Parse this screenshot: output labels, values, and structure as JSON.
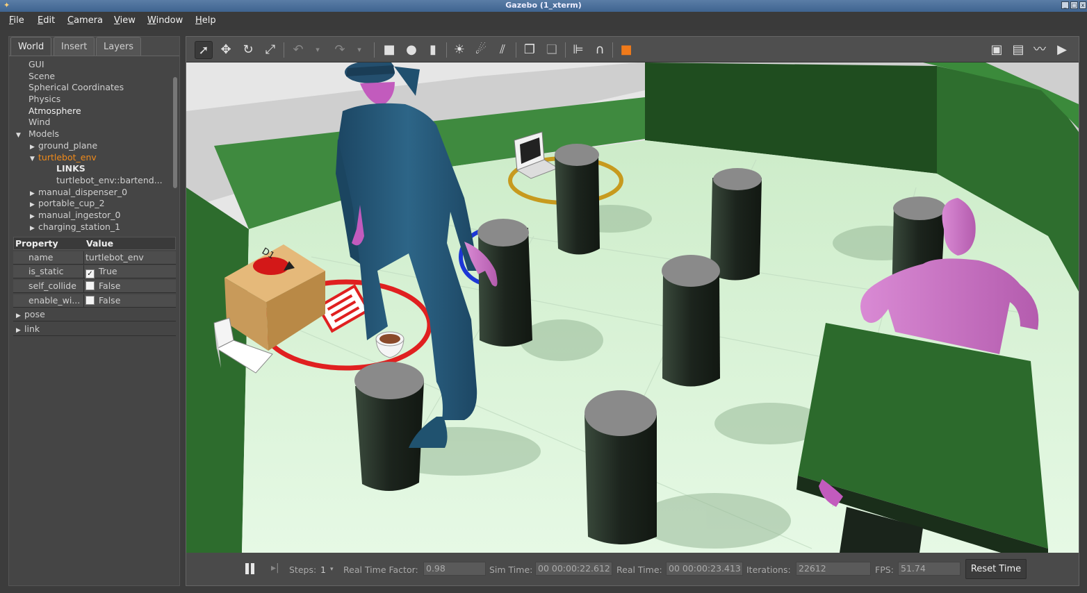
{
  "window": {
    "title": "Gazebo (1_xterm)"
  },
  "menu": [
    "File",
    "Edit",
    "Camera",
    "View",
    "Window",
    "Help"
  ],
  "tabs": [
    "World",
    "Insert",
    "Layers"
  ],
  "tree": {
    "items": [
      "GUI",
      "Scene",
      "Spherical Coordinates",
      "Physics",
      "Atmosphere",
      "Wind"
    ],
    "models_label": "Models",
    "models": [
      "ground_plane"
    ],
    "selected_model": "turtlebot_env",
    "links_label": "LINKS",
    "link_item": "turtlebot_env::bartend...",
    "more_models": [
      "manual_dispenser_0",
      "portable_cup_2",
      "manual_ingestor_0",
      "charging_station_1"
    ]
  },
  "properties": {
    "header_property": "Property",
    "header_value": "Value",
    "rows": [
      {
        "key": "name",
        "value": "turtlebot_env"
      },
      {
        "key": "is_static",
        "value": "True",
        "checked": true
      },
      {
        "key": "self_collide",
        "value": "False",
        "checked": false
      },
      {
        "key": "enable_wi...",
        "value": "False",
        "checked": false
      }
    ],
    "groups": [
      "pose",
      "link"
    ]
  },
  "toolbar_icons": [
    "select-mode-icon",
    "translate-icon",
    "rotate-icon",
    "scale-icon",
    "undo-icon",
    "redo-icon",
    "box-icon",
    "sphere-icon",
    "cylinder-icon",
    "point-light-icon",
    "spot-light-icon",
    "directional-light-icon",
    "copy-icon",
    "paste-icon",
    "align-icon",
    "snap-icon",
    "view-angle-icon",
    "screenshot-icon",
    "log-icon",
    "plot-icon",
    "record-icon"
  ],
  "bottom": {
    "steps_label": "Steps:",
    "steps_value": "1",
    "rtf_label": "Real Time Factor:",
    "rtf_value": "0.98",
    "sim_label": "Sim Time:",
    "sim_value": "00 00:00:22.612",
    "real_label": "Real Time:",
    "real_value": "00 00:00:23.413",
    "iter_label": "Iterations:",
    "iter_value": "22612",
    "fps_label": "FPS:",
    "fps_value": "51.74",
    "reset_label": "Reset Time"
  },
  "scene": {
    "dispenser_label": "D1",
    "colors": {
      "floor": "#dcf5dc",
      "walls": "#2e6e2e",
      "pillar": "#1f2a22",
      "pillar_top": "#8a8a8a",
      "person": "#cf6fc8",
      "uniform": "#2a5778",
      "table": "#2c6a2c"
    }
  }
}
